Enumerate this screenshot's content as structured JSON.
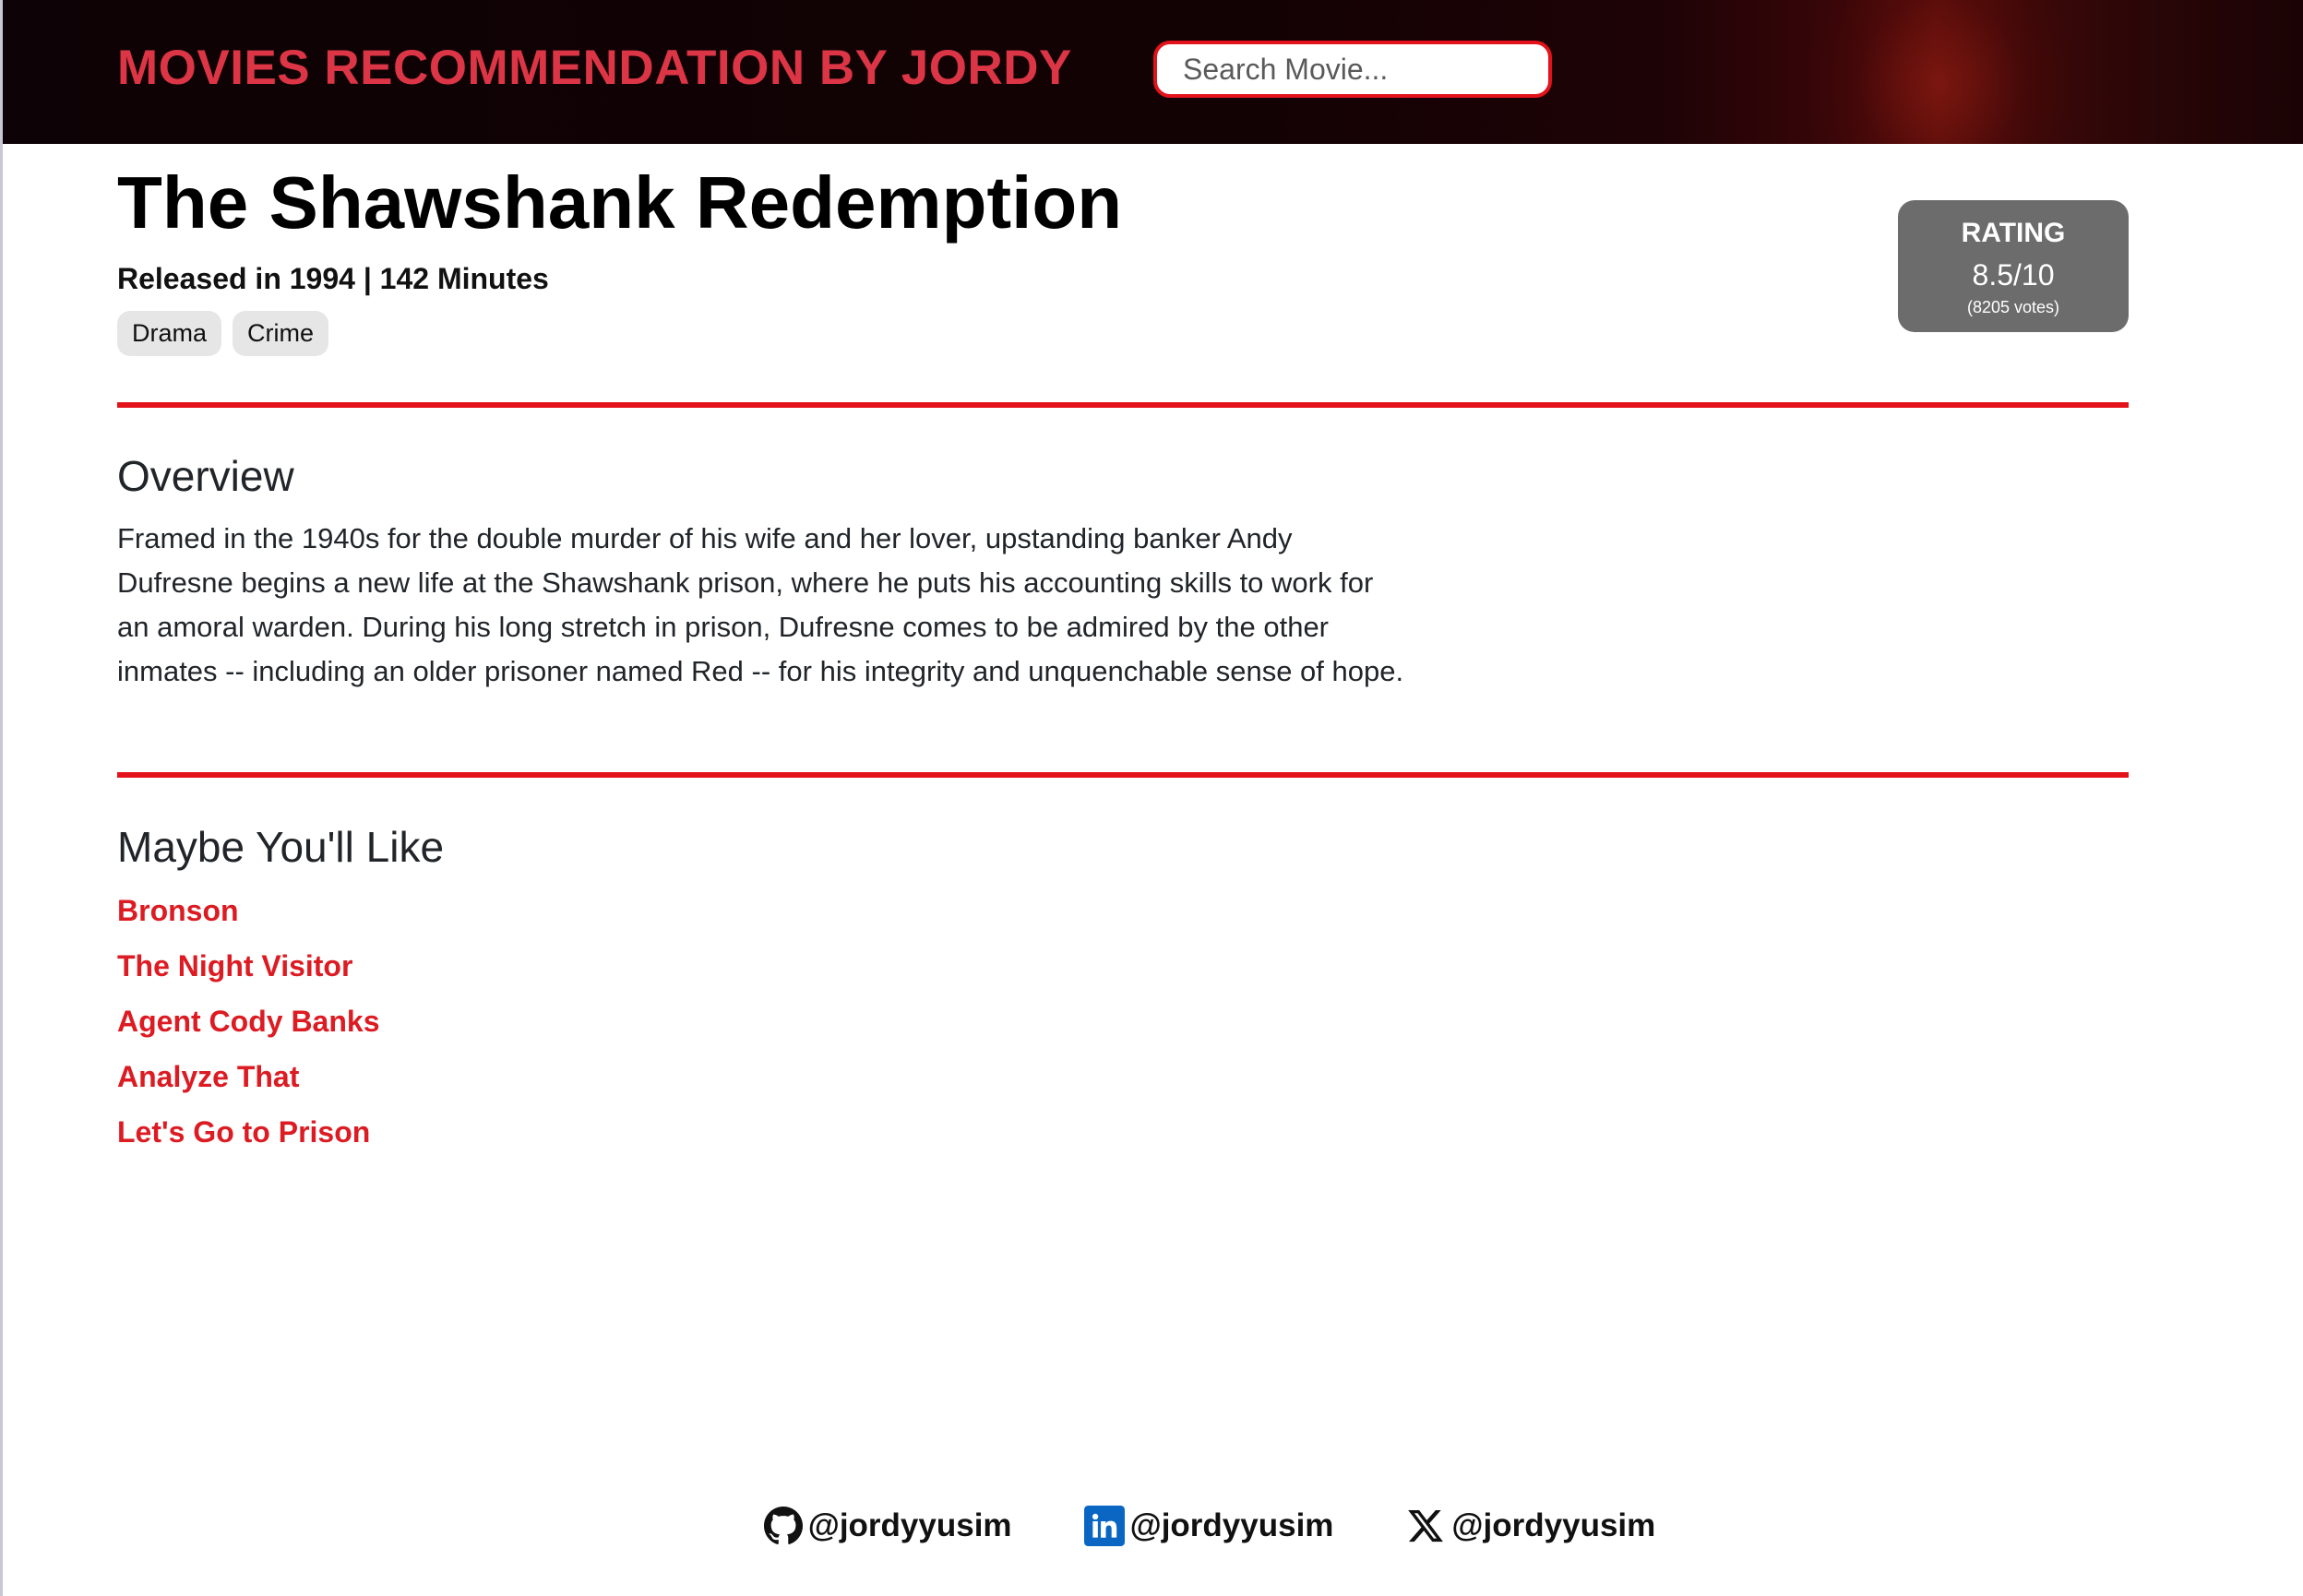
{
  "header": {
    "brand": "MOVIES RECOMMENDATION BY JORDY",
    "search_placeholder": "Search Movie..."
  },
  "movie": {
    "title": "The Shawshank Redemption",
    "meta": "Released in 1994 | 142 Minutes",
    "genres": [
      "Drama",
      "Crime"
    ],
    "rating": {
      "label": "RATING",
      "value": "8.5/10",
      "votes": "(8205 votes)"
    }
  },
  "overview": {
    "heading": "Overview",
    "text": "Framed in the 1940s for the double murder of his wife and her lover, upstanding banker Andy Dufresne begins a new life at the Shawshank prison, where he puts his accounting skills to work for an amoral warden. During his long stretch in prison, Dufresne comes to be admired by the other inmates -- including an older prisoner named Red -- for his integrity and unquenchable sense of hope."
  },
  "recommendations": {
    "heading": "Maybe You'll Like",
    "items": [
      "Bronson",
      "The Night Visitor",
      "Agent Cody Banks",
      "Analyze That",
      "Let's Go to Prison"
    ]
  },
  "footer": {
    "links": [
      {
        "icon": "github-icon",
        "handle": "@jordyyusim"
      },
      {
        "icon": "linkedin-icon",
        "handle": "@jordyyusim"
      },
      {
        "icon": "x-icon",
        "handle": "@jordyyusim"
      }
    ]
  },
  "colors": {
    "accent": "#dc3545",
    "rule": "#e3121b",
    "rating_bg": "#6c6c6c"
  }
}
